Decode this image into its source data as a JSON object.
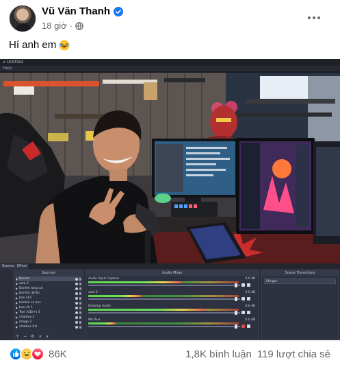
{
  "post": {
    "author_name": "Vũ Văn Thanh",
    "time": "18 giờ",
    "separator": "·",
    "caption": "Hí anh em",
    "caption_emoji": "laughing-emoji"
  },
  "screenshot": {
    "window_title": "u Untitled",
    "menu_help": "Help",
    "dock_tabs": [
      "Scenes",
      "Effect"
    ],
    "sources_title": "Sources",
    "mixer_title": "Audio Mixer",
    "transitions_title": "Scene Transitions",
    "sources": [
      {
        "label": "Beside",
        "selected": true
      },
      {
        "label": "cam 2",
        "selected": false
      },
      {
        "label": "Banhm long vai",
        "selected": false
      },
      {
        "label": "Banhm dj/dio",
        "selected": false
      },
      {
        "label": "ban nh1",
        "selected": false
      },
      {
        "label": "banhm sa bxx",
        "selected": false
      },
      {
        "label": "ban nh 1",
        "selected": false
      },
      {
        "label": "Text (GDI+) 3",
        "selected": false
      },
      {
        "label": "chatbox 2",
        "selected": false
      },
      {
        "label": "image 2",
        "selected": false
      },
      {
        "label": "chatbox full",
        "selected": false
      }
    ],
    "sources_toolbar": [
      "+",
      "−",
      "⚙",
      "∧",
      "∨"
    ],
    "mixer_channels": [
      {
        "label": "Audio Input Capture",
        "db": "0.0 dB",
        "level": 0.62,
        "fader": 0.98,
        "muted": false
      },
      {
        "label": "cam 2",
        "db": "0.0 dB",
        "level": 0.35,
        "fader": 0.98,
        "muted": false
      },
      {
        "label": "Desktop Audio",
        "db": "0.0 dB",
        "level": 0.78,
        "fader": 0.98,
        "muted": false
      },
      {
        "label": "Mic/Aux",
        "db": "0.0 dB",
        "level": 0.18,
        "fader": 0.98,
        "muted": true
      }
    ],
    "transition_selected": "Stinger"
  },
  "reactions": {
    "types": [
      "like",
      "haha",
      "love"
    ],
    "count": "86K"
  },
  "comments": "1,8K bình luận",
  "shares": "119 lượt chia sẻ"
}
